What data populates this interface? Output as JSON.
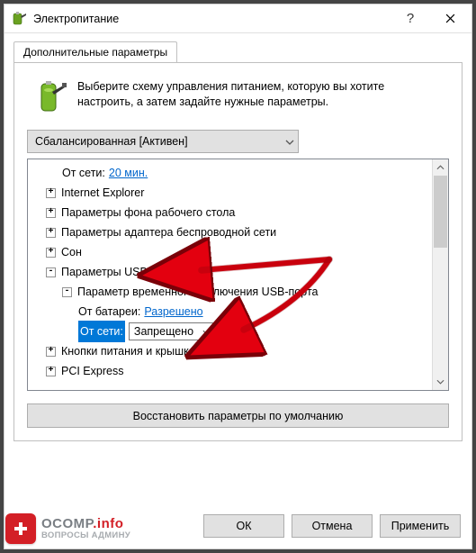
{
  "window": {
    "title": "Электропитание"
  },
  "tab": {
    "label": "Дополнительные параметры"
  },
  "intro": "Выберите схему управления питанием, которую вы хотите настроить, а затем задайте нужные параметры.",
  "plan": {
    "selected": "Сбалансированная [Активен]"
  },
  "tree": {
    "ac_label": "От сети:",
    "ac_value": "20 мин.",
    "ie": "Internet Explorer",
    "wallpaper": "Параметры фона рабочего стола",
    "wifi": "Параметры адаптера беспроводной сети",
    "sleep": "Сон",
    "usb": "Параметры USB",
    "usb_suspend": "Параметр временного отключения USB-порта",
    "battery_label": "От батареи:",
    "battery_value": "Разрешено",
    "ac2_label": "От сети:",
    "ac2_value": "Запрещено",
    "power_buttons": "Кнопки питания и крышка",
    "pci": "PCI Express"
  },
  "restore": "Восстановить параметры по умолчанию",
  "buttons": {
    "ok": "ОК",
    "cancel": "Отмена",
    "apply": "Применить"
  },
  "watermark": {
    "line1a": "OCOMP",
    "line1b": ".info",
    "line2": "ВОПРОСЫ АДМИНУ"
  }
}
